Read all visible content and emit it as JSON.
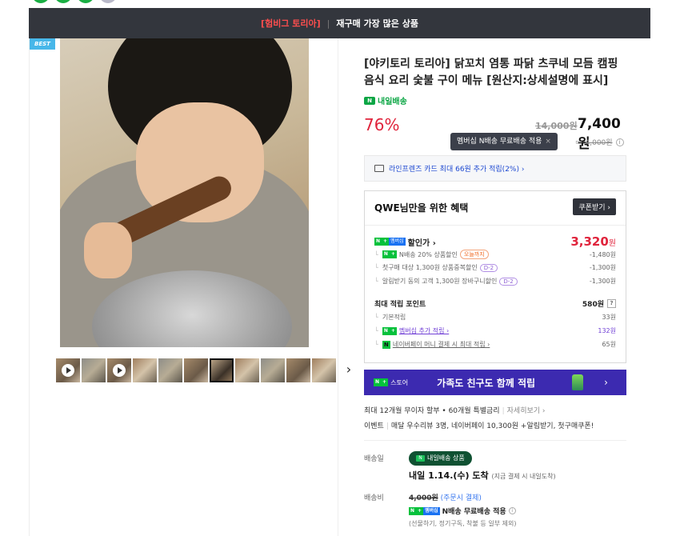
{
  "banner": {
    "highlight": "[험비그 토리아]",
    "separator": "|",
    "text": "재구매 가장 많은 상품"
  },
  "gallery": {
    "best_badge": "BEST",
    "next_arrow": "›"
  },
  "product": {
    "title": "[야키토리 토리아] 닭꼬치 염통 파닭 츠쿠네 모듬 캠핑 음식 요리 숯불 구이 메뉴 [원산지:상세설명에 표시]",
    "tomorrow_delivery": "내일배송",
    "discount_rate": "76%",
    "original_price": "14,000원",
    "price": "7,400원",
    "tooltip": "멤버십 N배송 무료배송 적용",
    "tooltip_close": "×",
    "membership_price": "4,000원"
  },
  "card_benefit": "라인프렌즈 카드 최대 66원 추가 적립(2%) ›",
  "benefit": {
    "header": "QWE님만을 위한 혜택",
    "coupon_button": "쿠폰받기 ›",
    "sale_label": "할인가 ›",
    "sale_price": "3,320",
    "sale_unit": "원",
    "rows": [
      {
        "label": "N배송 20% 상품할인",
        "tag": "오늘까지",
        "value": "-1,480원"
      },
      {
        "label": "첫구매 대상 1,300원 상품중복할인",
        "tag": "D-2",
        "value": "-1,300원"
      },
      {
        "label": "알림받기 동의 고객 1,300원 장바구니할인",
        "tag": "D-2",
        "value": "-1,300원"
      }
    ],
    "points_label": "최대 적립 포인트",
    "points_value": "580원",
    "points_help": "?",
    "point_rows": [
      {
        "label": "기본적립",
        "value": "33원"
      },
      {
        "label": "멤버십 추가 적립 ›",
        "value": "132원"
      },
      {
        "label": "네이버페이 머니 결제 시 최대 적립 ›",
        "value": "65원"
      }
    ],
    "badge_n": "N",
    "badge_plus": "+",
    "badge_membership": "멤버십"
  },
  "store_banner": {
    "brand": "스토어",
    "text": "가족도 친구도 함께 적립",
    "chevron": "›"
  },
  "installment": {
    "text": "최대 12개월 무이자 할부 • 60개월 특별금리",
    "link": "자세히보기 ›"
  },
  "event": {
    "label": "이벤트",
    "text": "매달 우수리뷰 3명, 네이버페이 10,300원 +알림받기, 첫구매쿠폰!"
  },
  "shipping": {
    "date_label": "배송일",
    "pill": "내일배송 상품",
    "arrive": "내일 1.14.(수) 도착",
    "arrive_sub": "(지금 결제 시 내일도착)",
    "fee_label": "배송비",
    "fee_strike": "4,000원",
    "fee_note": "(주문시 결제)",
    "free_text": "N배송 무료배송 적용",
    "exclude": "(선물하기, 정기구독, 착불 등 일부 제외)"
  },
  "colors": {
    "accent_red": "#e0243c",
    "naver_green": "#06c13c",
    "store_purple": "#3c2ab0"
  }
}
